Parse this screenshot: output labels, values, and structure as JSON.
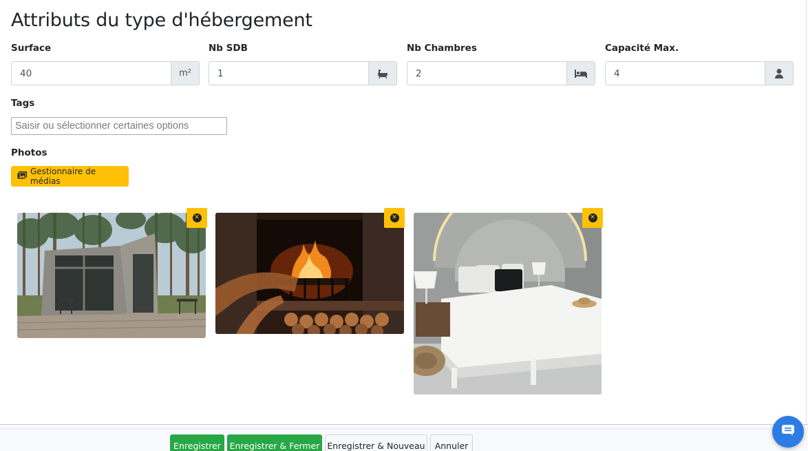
{
  "page": {
    "title": "Attributs du type d'hébergement"
  },
  "fields": [
    {
      "label": "Surface",
      "value": "40",
      "addon": "m²",
      "icon": "square-meter-unit"
    },
    {
      "label": "Nb SDB",
      "value": "1",
      "addon": "",
      "icon": "bath-icon"
    },
    {
      "label": "Nb Chambres",
      "value": "2",
      "addon": "",
      "icon": "bed-icon"
    },
    {
      "label": "Capacité Max.",
      "value": "4",
      "addon": "",
      "icon": "user-icon"
    }
  ],
  "tags": {
    "label": "Tags",
    "placeholder": "Saisir ou sélectionner certaines options"
  },
  "photos": {
    "label": "Photos",
    "media_button": "Gestionnaire de médias",
    "media_icon": "images-icon",
    "items": [
      {
        "subject": "cabin-in-forest",
        "remove_icon": "close-circle-icon"
      },
      {
        "subject": "fireplace",
        "remove_icon": "close-circle-icon"
      },
      {
        "subject": "bedroom",
        "remove_icon": "close-circle-icon"
      }
    ]
  },
  "footer": {
    "save": "Enregistrer",
    "save_close": "Enregistrer & Fermer",
    "save_new": "Enregistrer & Nouveau",
    "cancel": "Annuler"
  },
  "chat": {
    "icon": "chat-icon"
  },
  "colors": {
    "accent": "#ffc107",
    "success": "#28a745",
    "chat": "#2d7be5",
    "addon_bg": "#e9ecef"
  }
}
